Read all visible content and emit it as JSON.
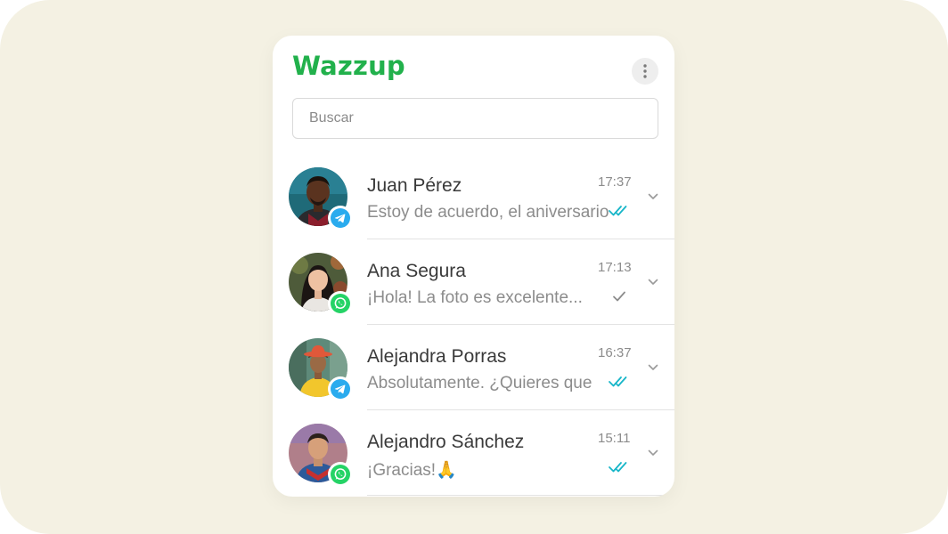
{
  "app": {
    "name": "Wazzup",
    "brand_color": "#22b14c",
    "background_color": "#f4f1e3"
  },
  "header": {
    "menu_icon": "more-vertical-icon"
  },
  "search": {
    "placeholder": "Buscar",
    "value": ""
  },
  "chats": [
    {
      "name": "Juan Pérez",
      "preview": "Estoy de acuerdo, el aniversario",
      "time": "17:37",
      "channel": "telegram",
      "status": "read"
    },
    {
      "name": "Ana Segura",
      "preview": "¡Hola! La foto es excelente...",
      "time": "17:13",
      "channel": "whatsapp",
      "status": "sent"
    },
    {
      "name": "Alejandra Porras",
      "preview": "Absolutamente. ¿Quieres que",
      "time": "16:37",
      "channel": "telegram",
      "status": "read"
    },
    {
      "name": "Alejandro Sánchez",
      "preview": "¡Gracias!🙏",
      "time": "15:11",
      "channel": "whatsapp",
      "status": "read"
    }
  ],
  "colors": {
    "telegram": "#2aabee",
    "whatsapp": "#25d366",
    "read_check": "#17b6c8",
    "sent_check": "#8c8c8c"
  }
}
